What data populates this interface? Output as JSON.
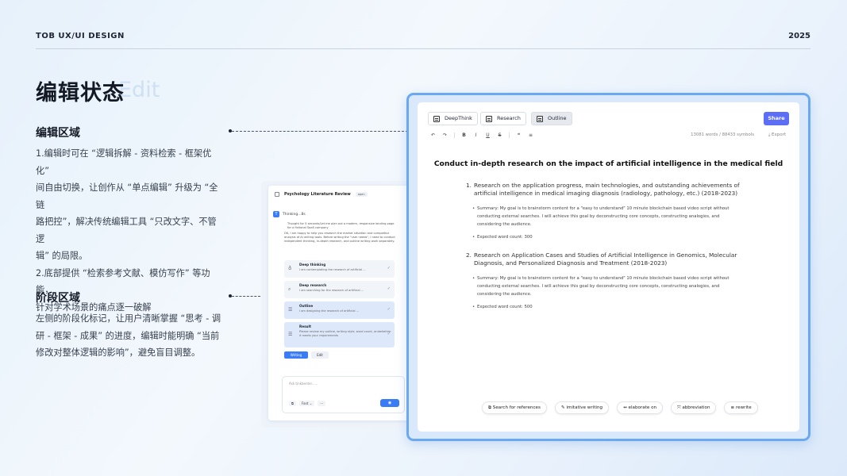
{
  "header": {
    "left": "TOB  UX/UI DESIGN",
    "right": "2025"
  },
  "title": {
    "main": "编辑状态",
    "ghost": "Edit"
  },
  "sections": [
    {
      "title": "编辑区域",
      "lines": [
        "1.编辑时可在 “逻辑拆解 - 资料检索 - 框架优化”",
        "间自由切换，让创作从 “单点编辑” 升级为 “全链",
        "路把控”，解决传统编辑工具 “只改文字、不管逻",
        "辑” 的局限。",
        "2.底部提供 “检索参考文献、模仿写作” 等功能，",
        "针对学术场景的痛点逐一破解"
      ]
    },
    {
      "title": "阶段区域",
      "lines": [
        "左侧的阶段化标记，让用户清晰掌握 “思考 - 调",
        "研 - 框架 - 成果” 的进度，编辑时能明确 “当前",
        "修改对整体逻辑的影响”，避免盲目调整。"
      ]
    }
  ],
  "panel": {
    "title": "Psychology Literature Review",
    "tag": "open",
    "avatar": "T",
    "thinking": "Thinking...8s",
    "thought": "Thought for 5 seconds/Let me plan out a modern, responsive landing page for a fictional SaaS company",
    "intro": "OK, I am happy to help you research the market situation and competitor analysis of AI writing tools. Before writing the \"user needs\", I need to conduct independent thinking, in-depth research, and outline writing work separately.",
    "stages": [
      {
        "title": "Deep thinking",
        "desc": "I am contemplating the research of artificial ...",
        "icon": "lightbulb"
      },
      {
        "title": "Deep research",
        "desc": "I am searching for the research of artificial ...",
        "icon": "search"
      },
      {
        "title": "Outline",
        "desc": "I am designing the research of artificial ...",
        "icon": "outline"
      },
      {
        "title": "Result",
        "desc": "Please review my outline, writing style, word count, andwhether it meets your requirements",
        "icon": "document"
      }
    ],
    "writing_btn": "Writing",
    "edit_btn": "Edit",
    "input_placeholder": "Ask tinkbenter......",
    "fast_label": "Fast",
    "more_label": "···"
  },
  "editor": {
    "tabs": [
      {
        "label": "DeepThink",
        "active": false
      },
      {
        "label": "Research",
        "active": false
      },
      {
        "label": "Outline",
        "active": true
      }
    ],
    "share": "Share",
    "toolbar": [
      "↶",
      "↷",
      "B",
      "I",
      "U",
      "S",
      "❝",
      "≡"
    ],
    "counts": "13081 words / 88433 symbols",
    "export": "⤓ Export",
    "doc_title": "Conduct in-depth research on the impact of artificial intelligence in the medical field",
    "items": [
      {
        "num": "1.",
        "text": "Research on the application progress, main technologies, and outstanding achievements of artificial intelligence in medical imaging diagnosis (radiology, pathology, etc.) (2018-2023)",
        "summary": "Summary: My goal is to brainstorm content for a \"easy to understand\" 10 minute blockchain based video script without conducting external searches. I will achieve this goal by deconstructing core concepts, constructing analogies, and considering the audience.",
        "count": "Expected word count: 300"
      },
      {
        "num": "2.",
        "text": "Research on Application Cases and Studies of Artificial Intelligence in Genomics, Molecular Diagnosis, and Personalized Diagnosis and Treatment (2018-2023)",
        "summary": "Summary: My goal is to brainstorm content for a \"easy to understand\" 10 minute blockchain based video script without conducting external searches. I will achieve this goal by deconstructing core concepts, constructing analogies, and considering the audience.",
        "count": "Expected word count: 500"
      }
    ],
    "chips": [
      {
        "label": "Search for references",
        "icon": "⧉"
      },
      {
        "label": "imitative writing",
        "icon": "✎"
      },
      {
        "label": "elaborate on",
        "icon": "↔"
      },
      {
        "label": "abbreviation",
        "icon": "⤧"
      },
      {
        "label": "rewrite",
        "icon": "≡"
      }
    ]
  },
  "colors": {
    "accent": "#3a7cf6",
    "share": "#5b6ef5",
    "frame": "#6aa9f2"
  }
}
